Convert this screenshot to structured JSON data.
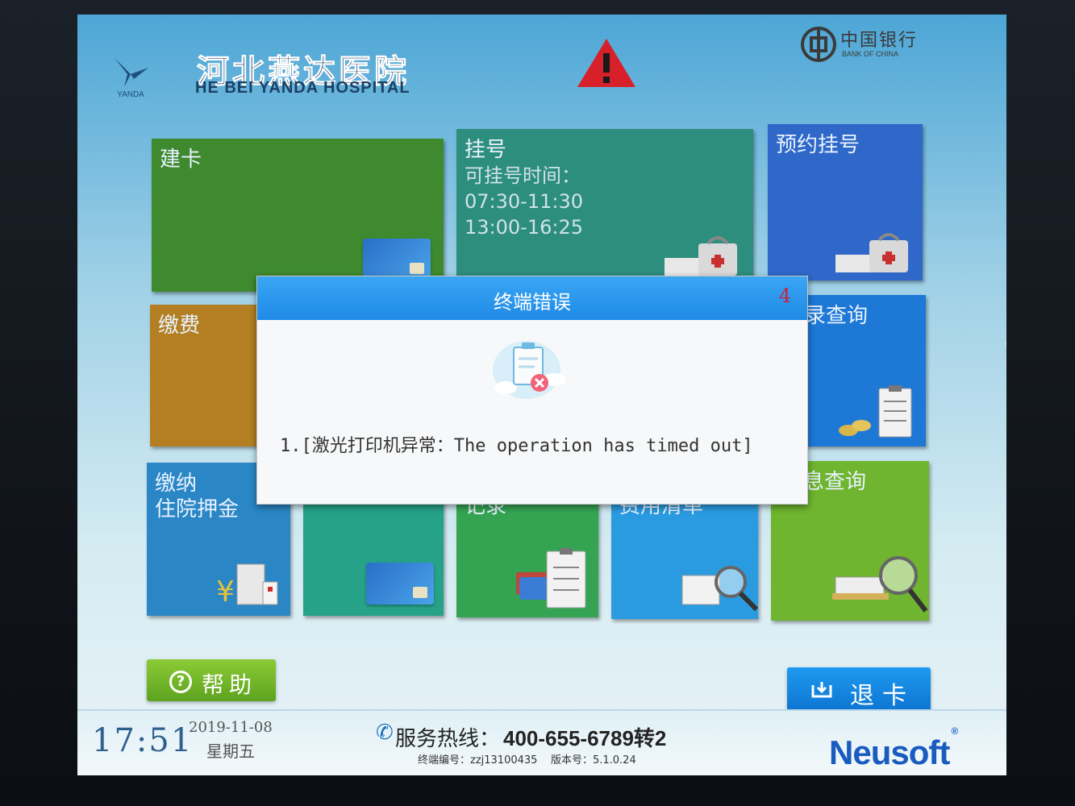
{
  "hospital": {
    "logo_text": "YANDA",
    "name_cn": "河北燕达医院",
    "name_en": "HE BEI YANDA HOSPITAL"
  },
  "bank": {
    "name_cn": "中国银行",
    "name_en": "BANK OF CHINA"
  },
  "tiles": {
    "create_card": {
      "label": "建卡",
      "color": "#3f8a2f"
    },
    "register": {
      "label": "挂号",
      "hours_label": "可挂号时间：",
      "morning": "07:30-11:30",
      "afternoon": "13:00-16:25",
      "color": "#2e8e7e"
    },
    "appointment": {
      "label": "预约挂号",
      "color": "#2f68c8"
    },
    "payment": {
      "label": "缴费",
      "color": "#b47f22"
    },
    "record_query": {
      "label": "录查询",
      "color": "#1d78d6"
    },
    "deposit": {
      "label_line1": "缴纳",
      "label_line2": "住院押金",
      "color": "#2a86c5"
    },
    "recharge": {
      "label": "",
      "color": "#25a288"
    },
    "records": {
      "label": "记录",
      "color": "#34a452"
    },
    "expense_list": {
      "label": "费用清单",
      "color": "#2a9be0"
    },
    "info_query": {
      "label": "息查询",
      "color": "#6fb52f"
    }
  },
  "buttons": {
    "help": {
      "icon_text": "?",
      "label": "帮助"
    },
    "exit_card": {
      "label": "退卡"
    }
  },
  "footer": {
    "time": "17:51",
    "date": "2019-11-08",
    "weekday": "星期五",
    "hotline_label": "服务热线：",
    "hotline_number": "400-655-6789转2",
    "terminal": "终端编号：zzj13100435",
    "version": "版本号：5.1.0.24",
    "brand": "Neusoft",
    "brand_mark": "®"
  },
  "dialog": {
    "title": "终端错误",
    "countdown": "4",
    "message": "1.[激光打印机异常：The operation has timed out]"
  }
}
